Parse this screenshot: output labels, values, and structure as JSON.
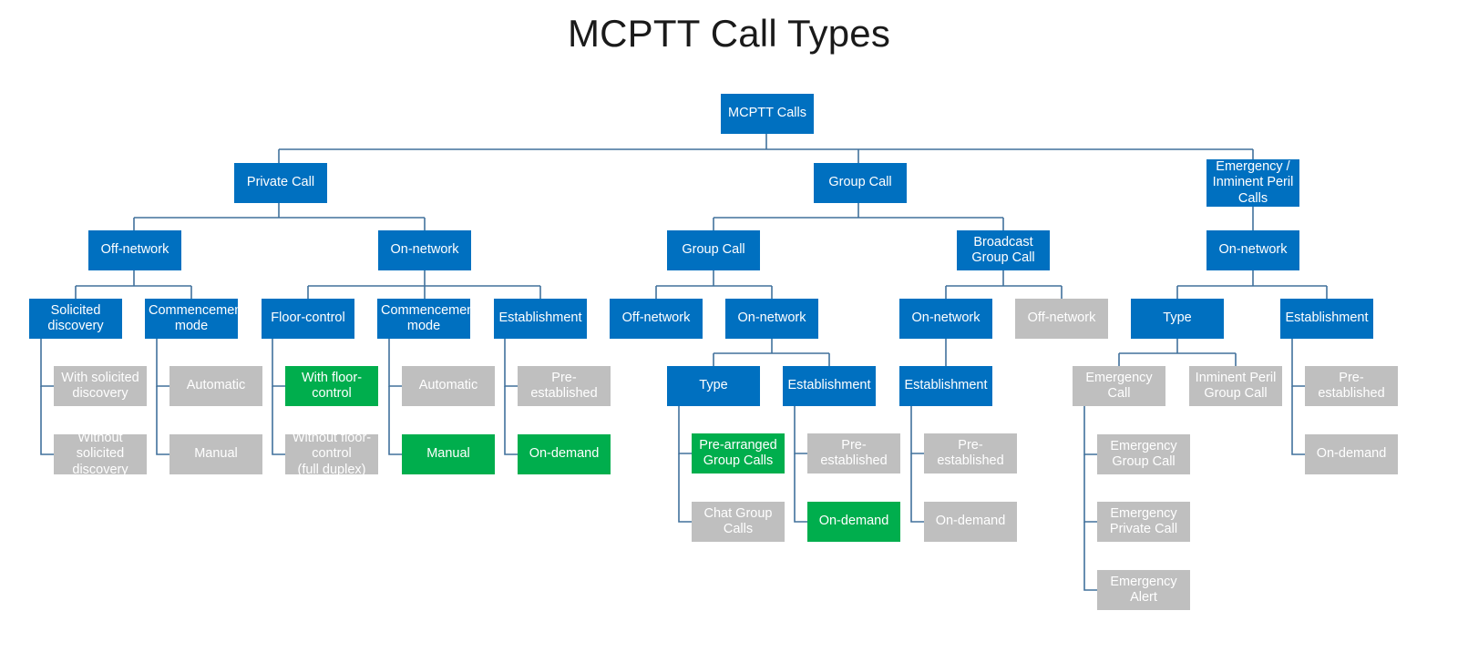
{
  "title": "MCPTT Call Types",
  "colors": {
    "blue": "#0070C0",
    "gray": "#BFBFBF",
    "green": "#00AE4D",
    "connector": "#41719C",
    "title_text": "#1a1a1a",
    "node_text": "#ffffff",
    "background": "#ffffff"
  },
  "nodes": {
    "root": "MCPTT Calls",
    "private_call": "Private Call",
    "group_call": "Group Call",
    "emergency_calls": "Emergency /\nInminent Peril\nCalls",
    "pc_off_network": "Off-network",
    "pc_on_network": "On-network",
    "pc_off_solicited_discovery": "Solicited\ndiscovery",
    "pc_off_commencement_mode": "Commencement\nmode",
    "pc_on_floor_control": "Floor-control",
    "pc_on_commencement_mode": "Commencement\nmode",
    "pc_on_establishment": "Establishment",
    "with_solicited_discovery": "With solicited\ndiscovery",
    "without_solicited_discovery": "Without\nsolicited\ndiscovery",
    "pc_off_automatic": "Automatic",
    "pc_off_manual": "Manual",
    "with_floor_control": "With floor-\ncontrol",
    "without_floor_control": "Without floor-\ncontrol\n(full duplex)",
    "pc_on_automatic": "Automatic",
    "pc_on_manual": "Manual",
    "pc_on_pre_established": "Pre-established",
    "pc_on_on_demand": "On-demand",
    "gc_group_call": "Group Call",
    "gc_broadcast_group_call": "Broadcast\nGroup Call",
    "gc_off_network": "Off-network",
    "gc_on_network": "On-network",
    "bgc_on_network": "On-network",
    "bgc_off_network": "Off-network",
    "gc_type": "Type",
    "gc_establishment": "Establishment",
    "bgc_establishment": "Establishment",
    "pre_arranged_group_calls": "Pre-arranged\nGroup Calls",
    "chat_group_calls": "Chat Group Calls",
    "gc_pre_established": "Pre-established",
    "gc_on_demand": "On-demand",
    "bgc_pre_established": "Pre-established",
    "bgc_on_demand": "On-demand",
    "em_on_network": "On-network",
    "em_type": "Type",
    "em_establishment": "Establishment",
    "emergency_call": "Emergency Call",
    "inminent_peril_group_call": "Inminent Peril\nGroup Call",
    "em_pre_established": "Pre-established",
    "em_on_demand": "On-demand",
    "emergency_group_call": "Emergency\nGroup Call",
    "emergency_private_call": "Emergency\nPrivate Call",
    "emergency_alert": "Emergency Alert"
  }
}
